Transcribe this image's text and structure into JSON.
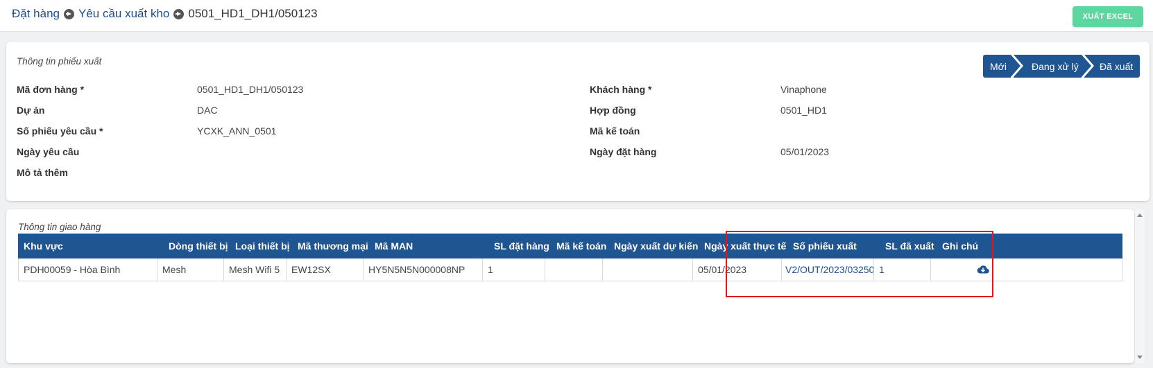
{
  "breadcrumb": {
    "items": [
      "Đặt hàng",
      "Yêu cầu xuất kho"
    ],
    "current": "0501_HD1_DH1/050123"
  },
  "toolbar": {
    "export_label": "XUẤT EXCEL"
  },
  "info": {
    "title": "Thông tin phiếu xuất",
    "steps": [
      "Mới",
      "Đang xử lý",
      "Đã xuất"
    ],
    "left": [
      {
        "label": "Mã đơn hàng *",
        "value": "0501_HD1_DH1/050123"
      },
      {
        "label": "Dự án",
        "value": "DAC"
      },
      {
        "label": "Số phiếu yêu cầu *",
        "value": "YCXK_ANN_0501"
      },
      {
        "label": "Ngày yêu cầu",
        "value": ""
      },
      {
        "label": "Mô tả thêm",
        "value": ""
      }
    ],
    "right": [
      {
        "label": "Khách hàng *",
        "value": "Vinaphone"
      },
      {
        "label": "Hợp đồng",
        "value": "0501_HD1"
      },
      {
        "label": "Mã kế toán",
        "value": ""
      },
      {
        "label": "Ngày đặt hàng",
        "value": "05/01/2023"
      }
    ]
  },
  "delivery": {
    "title": "Thông tin giao hàng",
    "columns": [
      "Khu vực",
      "Dòng thiết bị",
      "Loại thiết bị",
      "Mã thương mại",
      "Mã MAN",
      "SL đặt hàng",
      "Mã kế toán",
      "Ngày xuất dự kiến",
      "Ngày xuất thực tế",
      "Số phiếu xuất",
      "SL đã xuất",
      "Ghi chú"
    ],
    "rows": [
      {
        "khu_vuc": "PDH00059 - Hòa Bình",
        "dong_thiet_bi": "Mesh",
        "loai_thiet_bi": "Mesh Wifi 5",
        "ma_thuong_mai": "EW12SX",
        "ma_man": "HY5N5N5N000008NP",
        "sl_dat_hang": "1",
        "ma_ke_toan": "",
        "ngay_xuat_du_kien": "",
        "ngay_xuat_thuc_te": "05/01/2023",
        "so_phieu_xuat": "V2/OUT/2023/03250",
        "sl_da_xuat": "1",
        "ghi_chu": ""
      }
    ]
  },
  "colors": {
    "primary": "#1f5591",
    "export_button": "#5fd6a0",
    "highlight": "#e3161b"
  }
}
